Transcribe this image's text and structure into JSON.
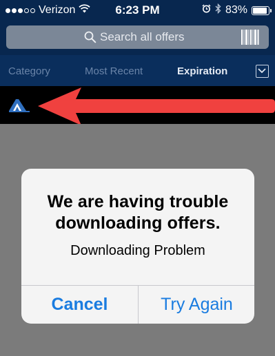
{
  "status_bar": {
    "carrier": "Verizon",
    "signal_bars_filled": 3,
    "signal_bars_total": 5,
    "time": "6:23 PM",
    "battery": "83%",
    "battery_level": 0.83
  },
  "search": {
    "placeholder": "Search all offers"
  },
  "tabs": [
    {
      "label": "Category"
    },
    {
      "label": "Most Recent"
    },
    {
      "label": "Expiration"
    }
  ],
  "alert": {
    "title": "We are having trouble downloading offers.",
    "message": "Downloading Problem",
    "cancel_label": "Cancel",
    "retry_label": "Try Again"
  },
  "colors": {
    "nav_background": "#08274f",
    "annotation_arrow": "#f0413f",
    "alert_button": "#1a7ce0"
  },
  "icons": {
    "search": "search-icon",
    "barcode": "barcode-icon",
    "wifi": "wifi-icon",
    "alarm": "alarm-icon",
    "bluetooth": "bluetooth-icon",
    "battery": "battery-icon",
    "dropdown": "chevron-down-icon",
    "store_logo": "store-logo"
  }
}
